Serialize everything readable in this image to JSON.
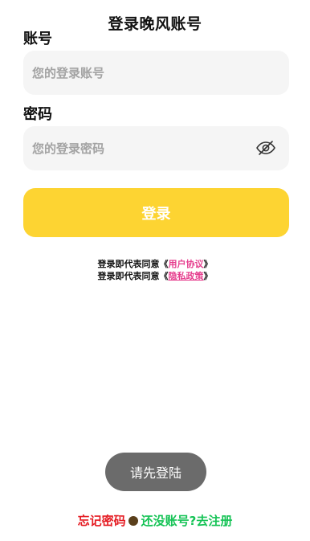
{
  "header": {
    "title": "登录晚风账号"
  },
  "form": {
    "account_label": "账号",
    "account_placeholder": "您的登录账号",
    "account_value": "",
    "password_label": "密码",
    "password_placeholder": "您的登录密码",
    "password_value": "",
    "password_toggle_icon": "eye-off-icon",
    "login_button_label": "登录"
  },
  "agreement": {
    "prefix": "登录即代表同意《",
    "user_agreement": "用户协议",
    "privacy_policy": "隐私政策",
    "suffix": "》"
  },
  "toast": {
    "message": "请先登陆"
  },
  "footer": {
    "forgot_password": "忘记密码",
    "register": "还没账号?去注册"
  },
  "colors": {
    "login_button": "#fdd432",
    "link": "#e6408f",
    "forgot": "#e51c23",
    "register": "#16c356",
    "input_bg": "#f5f5f5",
    "toast_bg": "#6b6b6b"
  }
}
